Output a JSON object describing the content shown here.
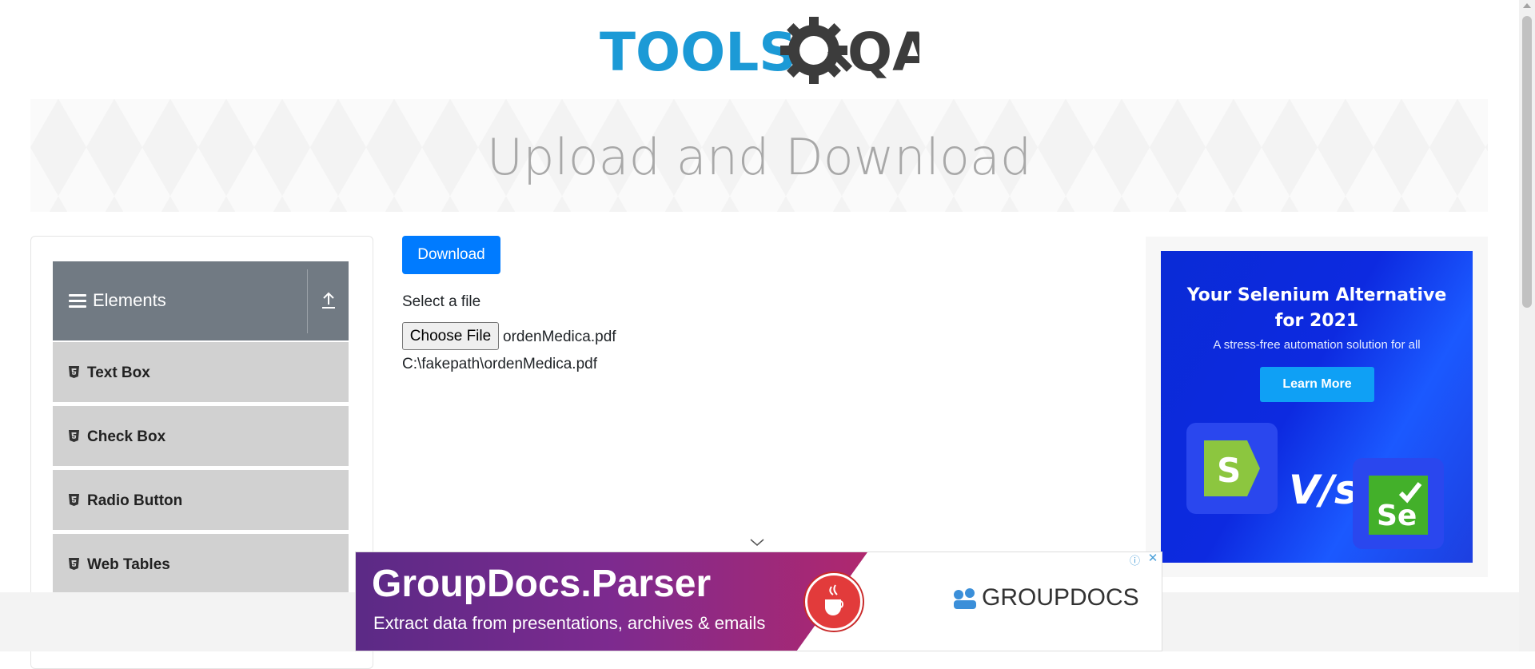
{
  "logo": {
    "text_primary": "TOOLS",
    "text_secondary": "QA"
  },
  "banner": {
    "title": "Upload and Download"
  },
  "sidebar": {
    "group": {
      "label": "Elements"
    },
    "items": [
      {
        "label": "Text Box"
      },
      {
        "label": "Check Box"
      },
      {
        "label": "Radio Button"
      },
      {
        "label": "Web Tables"
      }
    ]
  },
  "main": {
    "download_label": "Download",
    "select_label": "Select a file",
    "choose_file_label": "Choose File",
    "chosen_file_name": "ordenMedica.pdf",
    "uploaded_path": "C:\\fakepath\\ordenMedica.pdf"
  },
  "ad_right": {
    "title_line1": "Your Selenium Alternative",
    "title_line2": "for 2021",
    "subtitle": "A stress-free automation solution for all",
    "cta_label": "Learn More",
    "vs_text": "V/s",
    "tile1_letter": "S",
    "tile2_letter": "Se"
  },
  "ad_bottom": {
    "headline": "GroupDocs.Parser",
    "tagline": "Extract data from presentations, archives & emails",
    "brand": "GROUPDOCS"
  },
  "colors": {
    "primary": "#007bff",
    "sidebar_header": "#717a83",
    "sidebar_item": "#d1d1d1",
    "logo_blue": "#1c9ad6",
    "logo_dark": "#3c3c3c"
  }
}
